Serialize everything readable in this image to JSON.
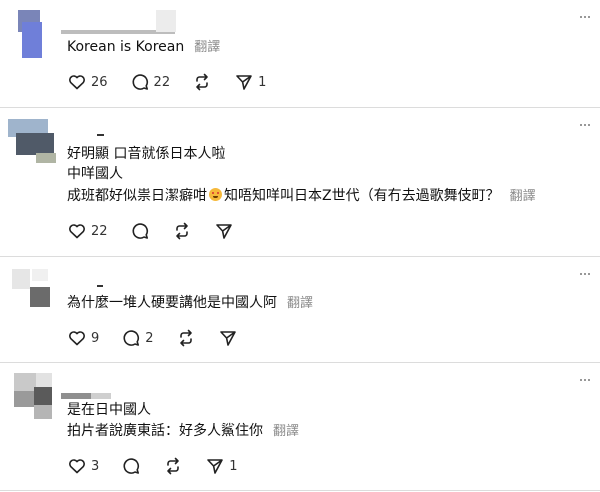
{
  "translate_label": "翻譯",
  "posts": [
    {
      "lines": [
        "Korean is Korean"
      ],
      "likes": "26",
      "replies": "22",
      "reposts": "",
      "shares": "1"
    },
    {
      "lines": [
        "好明顯 口音就係日本人啦",
        "中咩國人",
        "成班都好似祟日潔癖咁",
        "知唔知咩叫日本Z世代（有冇去過歌舞伎町？"
      ],
      "likes": "22",
      "replies": "",
      "reposts": "",
      "shares": ""
    },
    {
      "lines": [
        "為什麼一堆人硬要講他是中國人阿"
      ],
      "likes": "9",
      "replies": "2",
      "reposts": "",
      "shares": ""
    },
    {
      "lines": [
        "是在日中國人",
        "拍片者說廣東話：好多人鯊住你"
      ],
      "likes": "3",
      "replies": "",
      "reposts": "",
      "shares": "1"
    }
  ]
}
